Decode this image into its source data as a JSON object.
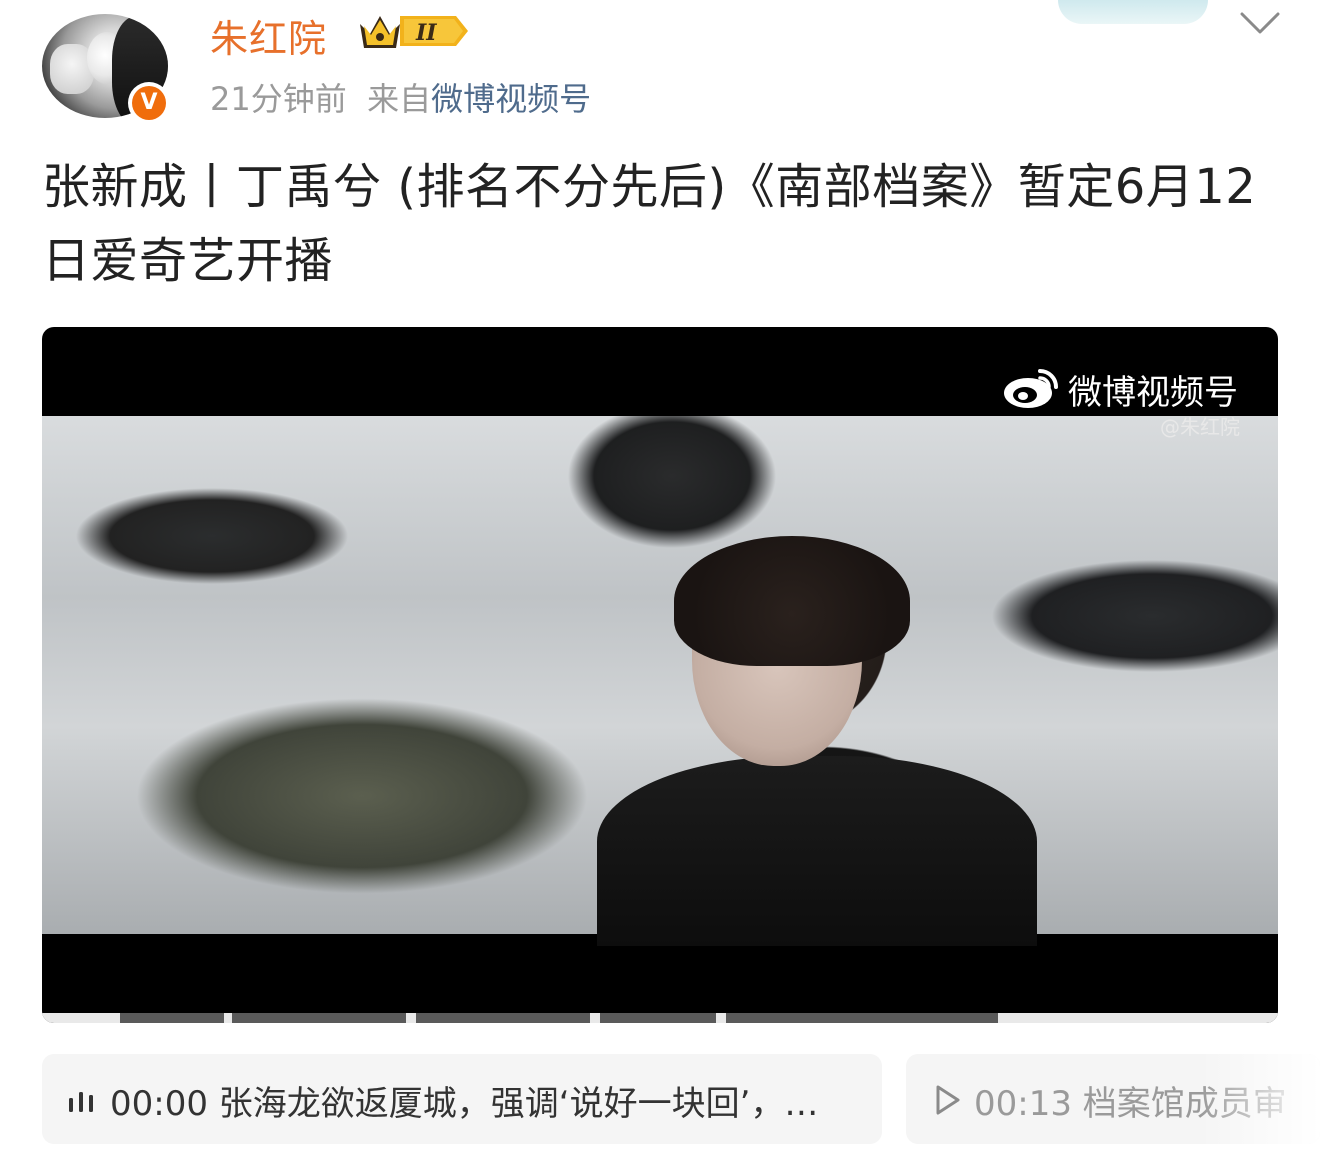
{
  "header": {
    "username": "朱红院",
    "vip_level": "II",
    "time": "21分钟前",
    "source_prefix": "来自",
    "source": "微博视频号",
    "verify_mark": "V"
  },
  "post": {
    "text": "张新成丨丁禹兮 (排名不分先后)《南部档案》暂定6月12日爱奇艺开播"
  },
  "video": {
    "watermark_label": "微博视频号",
    "watermark_handle": "@朱红院"
  },
  "chapters": [
    {
      "time": "00:00",
      "title": "张海龙欲返厦城，强调‘说好一块回’，…",
      "state": "playing"
    },
    {
      "time": "00:13",
      "title": "档案馆成员审",
      "state": "paused"
    }
  ],
  "colors": {
    "username": "#e7702b",
    "source_link": "#4f6b8c",
    "verify_badge": "#f06d0c"
  },
  "icons": {
    "vip": "crown-vip-icon",
    "menu": "chevron-down-icon",
    "logo": "weibo-logo-icon",
    "chapter_playing": "sound-bars-icon",
    "chapter_paused": "play-icon"
  }
}
